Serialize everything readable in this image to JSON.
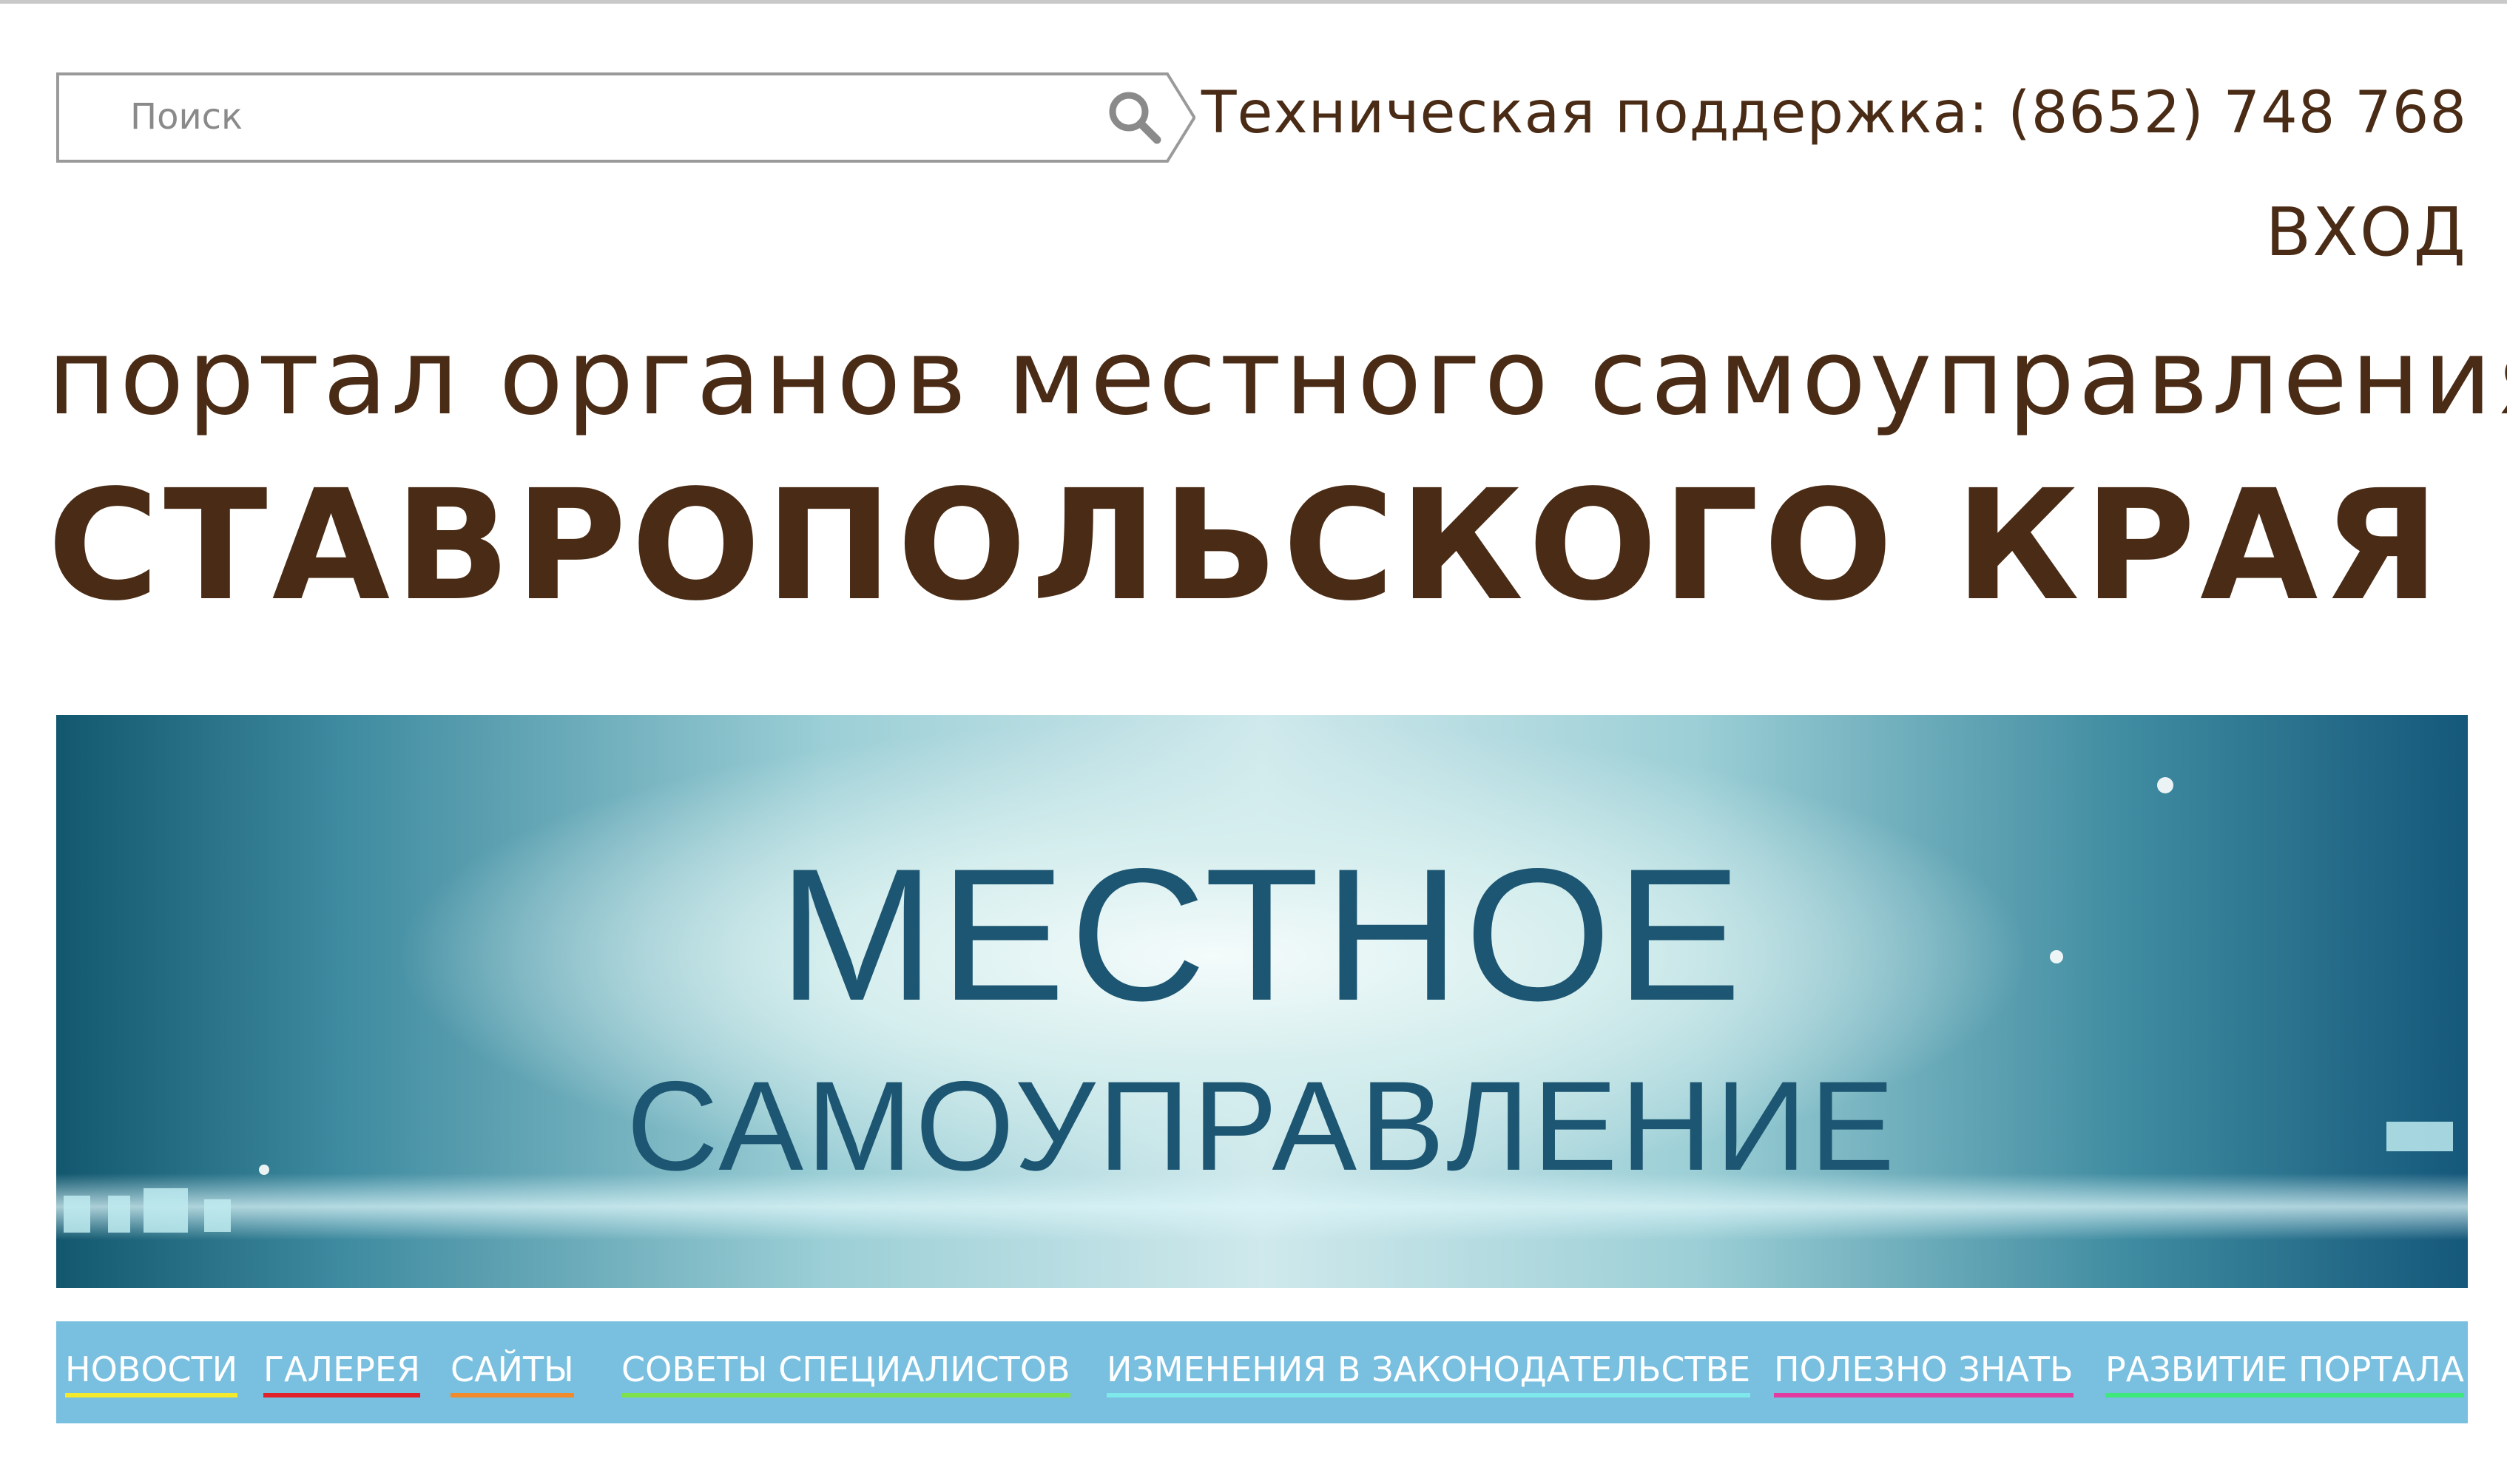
{
  "search": {
    "placeholder": "Поиск",
    "icon": "search-icon"
  },
  "header": {
    "support_text": "Техническая поддержка: (8652) 748 768",
    "login_label": "ВХОД",
    "title_line1": "портал органов местного самоуправления",
    "title_line2": "СТАВРОПОЛЬСКОГО КРАЯ"
  },
  "banner": {
    "line1": "МЕСТНОЕ",
    "line2": "САМОУПРАВЛЕНИЕ"
  },
  "nav": {
    "items": [
      {
        "label": "НОВОСТИ",
        "color": "#f4e92a"
      },
      {
        "label": "ГАЛЕРЕЯ",
        "color": "#e0202a"
      },
      {
        "label": "САЙТЫ",
        "color": "#f08a2a"
      },
      {
        "label": "СОВЕТЫ СПЕЦИАЛИСТОВ",
        "color": "#7ee04a"
      },
      {
        "label": "ИЗМЕНЕНИЯ В ЗАКОНОДАТЕЛЬСТВЕ",
        "color": "#7fe8ea"
      },
      {
        "label": "ПОЛЕЗНО ЗНАТЬ",
        "color": "#e23aa0"
      },
      {
        "label": "РАЗВИТИЕ ПОРТАЛА",
        "color": "#3ee87a"
      }
    ]
  },
  "colors": {
    "brand_brown": "#4a2c16",
    "nav_bg": "#79bfdf",
    "banner_text": "#1d5672"
  }
}
